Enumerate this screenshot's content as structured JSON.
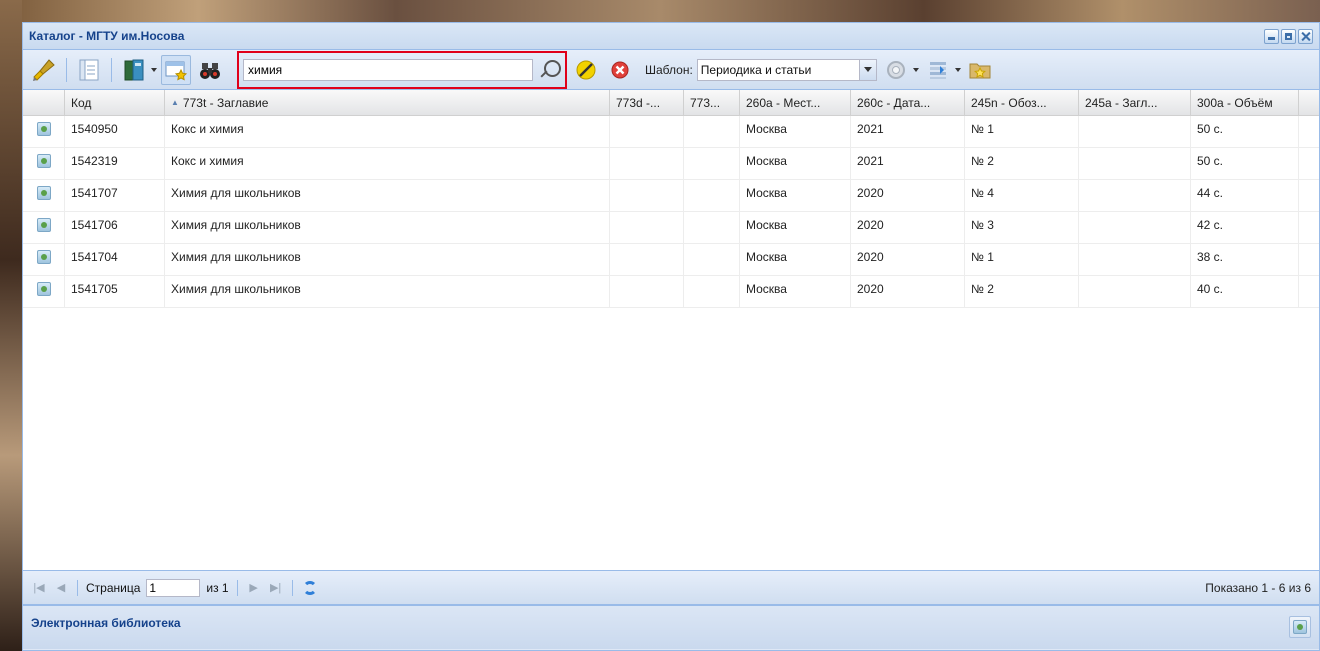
{
  "window": {
    "title": "Каталог - МГТУ им.Носова"
  },
  "toolbar": {
    "icons": [
      "brush-icon",
      "form-view-icon",
      "book-icon",
      "favorites-icon",
      "binoculars-icon",
      "clear-filter-icon",
      "cancel-icon",
      "settings-icon",
      "list-icon",
      "folder-star-icon"
    ],
    "search_value": "химия",
    "template_label": "Шаблон:",
    "template_value": "Периодика и статьи"
  },
  "grid": {
    "columns": [
      "",
      "Код",
      "773t - Заглавие",
      "773d -...",
      "773...",
      "260a - Мест...",
      "260c - Дата...",
      "245n - Обоз...",
      "245a - Загл...",
      "300a - Объём"
    ],
    "sort_indicator": "▲",
    "rows": [
      {
        "code": "1540950",
        "title": "Кокс и химия",
        "c773d": "",
        "c773": "",
        "place": "Москва",
        "date": "2021",
        "num": "№ 1",
        "t245a": "",
        "volume": "50 с."
      },
      {
        "code": "1542319",
        "title": "Кокс и химия",
        "c773d": "",
        "c773": "",
        "place": "Москва",
        "date": "2021",
        "num": "№ 2",
        "t245a": "",
        "volume": "50 с."
      },
      {
        "code": "1541707",
        "title": "Химия для школьников",
        "c773d": "",
        "c773": "",
        "place": "Москва",
        "date": "2020",
        "num": "№ 4",
        "t245a": "",
        "volume": "44 с."
      },
      {
        "code": "1541706",
        "title": "Химия для школьников",
        "c773d": "",
        "c773": "",
        "place": "Москва",
        "date": "2020",
        "num": "№ 3",
        "t245a": "",
        "volume": "42 с."
      },
      {
        "code": "1541704",
        "title": "Химия для школьников",
        "c773d": "",
        "c773": "",
        "place": "Москва",
        "date": "2020",
        "num": "№ 1",
        "t245a": "",
        "volume": "38 с."
      },
      {
        "code": "1541705",
        "title": "Химия для школьников",
        "c773d": "",
        "c773": "",
        "place": "Москва",
        "date": "2020",
        "num": "№ 2",
        "t245a": "",
        "volume": "40 с."
      }
    ]
  },
  "paging": {
    "page_label": "Страница",
    "page_value": "1",
    "of_label": "из 1",
    "info": "Показано 1 - 6 из 6"
  },
  "bottom_panel": {
    "title": "Электронная библиотека"
  },
  "colors": {
    "accent": "#15428b",
    "highlight_border": "#e0001a"
  }
}
